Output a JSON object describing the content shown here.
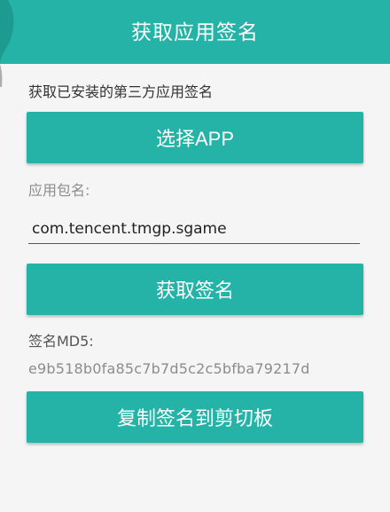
{
  "toolbar": {
    "title": "获取应用签名",
    "color": "#25b2a7"
  },
  "main": {
    "subtitle": "获取已安装的第三方应用签名",
    "select_app_button": "选择APP",
    "package_label": "应用包名:",
    "package_input_value": "com.tencent.tmgp.sgame",
    "get_signature_button": "获取签名",
    "md5_label": "签名MD5:",
    "md5_value": "e9b518b0fa85c7b7d5c2c5bfba79217d",
    "copy_button": "复制签名到剪切板"
  }
}
